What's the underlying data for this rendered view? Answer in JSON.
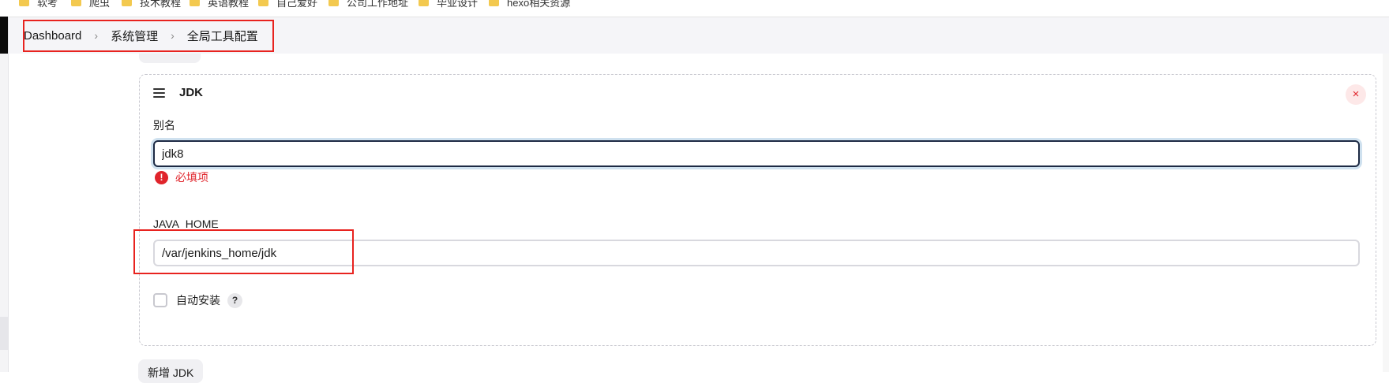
{
  "bookmarks": [
    "软考",
    "爬虫",
    "技术教程",
    "英语教程",
    "自己爱好",
    "公司工作地址",
    "毕业设计",
    "hexo相关资源"
  ],
  "breadcrumb": {
    "items": [
      "Dashboard",
      "系统管理",
      "全局工具配置"
    ],
    "separator": "›"
  },
  "jdk_card": {
    "title": "JDK",
    "close_symbol": "×",
    "alias_label": "别名",
    "alias_value": "jdk8",
    "error_text": "必填项",
    "error_symbol": "!",
    "java_home_label": "JAVA_HOME",
    "java_home_value": "/var/jenkins_home/jdk",
    "auto_install_label": "自动安装",
    "help_symbol": "?"
  },
  "add_button_label": "新增 JDK",
  "colors": {
    "annotation_red": "#e8231f",
    "error_red": "#e0242b",
    "focus_border": "#1d2a44"
  },
  "icons": [
    "folder-icon",
    "drag-handle-icon",
    "close-icon",
    "error-icon",
    "help-icon",
    "chevron-right-icon"
  ]
}
